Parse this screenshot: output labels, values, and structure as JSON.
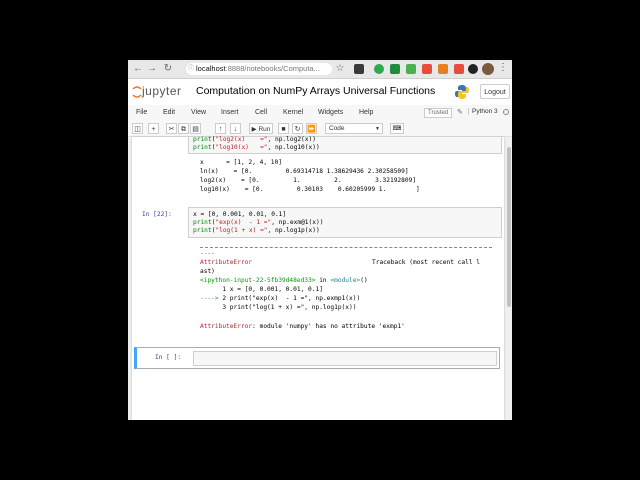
{
  "browser": {
    "address_domain": "localhost",
    "address_path": ":8888/notebooks/Computa...",
    "back_icon": "arrow-left-icon",
    "forward_icon": "arrow-right-icon",
    "reload_icon": "reload-icon"
  },
  "header": {
    "logo_text": "jupyter",
    "notebook_title": "Computation on NumPy Arrays Universal Functions",
    "logout_label": "Logout"
  },
  "menu": {
    "items": [
      "File",
      "Edit",
      "View",
      "Insert",
      "Cell",
      "Kernel",
      "Widgets",
      "Help"
    ],
    "trusted_label": "Trusted",
    "kernel_label": "Python 3"
  },
  "toolbar": {
    "run_label": "Run",
    "cell_type": "Code"
  },
  "cells": {
    "partial_top_code_line1_fn": "print",
    "partial_top_code_line1_str": "\"log2(x)    =\"",
    "partial_top_code_line1_rest": ", np.log2(x))",
    "partial_top_code_line2_fn": "print",
    "partial_top_code_line2_str": "\"log10(x)   =\"",
    "partial_top_code_line2_rest": ", np.log10(x))",
    "output_lines": [
      "x      = [1, 2, 4, 10]",
      "ln(x)    = [0.         0.69314718 1.38629436 2.30258509]",
      "log2(x)    = [0.         1.         2.         3.32192809]",
      "log10(x)    = [0.         0.30103    0.60205999 1.        ]"
    ],
    "cell22_prompt": "In [22]:",
    "cell22_line1": "x = [0, 0.001, 0.01, 0.1]",
    "cell22_line2_fn": "print",
    "cell22_line2_str": "\"exp(x)  - 1 =\"",
    "cell22_line2_rest": ", np.exm@1(x))",
    "cell22_line3_fn": "print",
    "cell22_line3_str": "\"log(1 + x) =\"",
    "cell22_line3_rest": ", np.log1p(x))",
    "traceback_dashes": "----",
    "error_name": "AttributeError",
    "traceback_header": "Traceback (most recent call l",
    "traceback_header_wrap": "ast)",
    "ipython_input": "<ipython-input-22-5fb39d48ed33>",
    "in_word": " in ",
    "module_word": "<module>",
    "module_parens": "()",
    "tb_line1": "      1 x = [0, 0.001, 0.01, 0.1]",
    "tb_line2_arrow": "----> ",
    "tb_line2": "2 print(\"exp(x)  - 1 =\", np.exmp1(x))",
    "tb_line3": "      3 print(\"log(1 + x) =\", np.log1p(x))",
    "error_message": ": module 'numpy' has no attribute 'exmp1'",
    "empty_prompt": "In [ ]:"
  }
}
